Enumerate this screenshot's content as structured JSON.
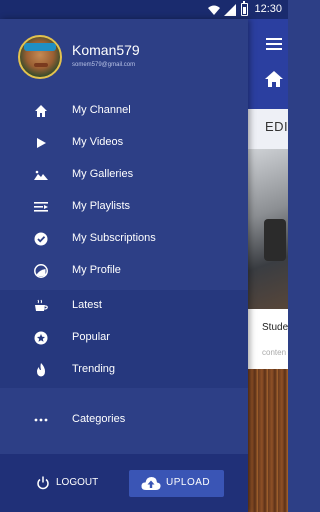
{
  "status_bar": {
    "time": "12:30"
  },
  "drawer": {
    "profile": {
      "username": "Koman579",
      "email": "somem579@gmail.com"
    },
    "primary_items": [
      {
        "label": "My Channel",
        "icon": "home-icon"
      },
      {
        "label": "My Videos",
        "icon": "play-icon"
      },
      {
        "label": "My Galleries",
        "icon": "landscape-icon"
      },
      {
        "label": "My Playlists",
        "icon": "playlist-icon"
      },
      {
        "label": "My Subscriptions",
        "icon": "check-circle-icon"
      },
      {
        "label": "My Profile",
        "icon": "profile-icon"
      }
    ],
    "feed_items": [
      {
        "label": "Latest",
        "icon": "coffee-cup-icon"
      },
      {
        "label": "Popular",
        "icon": "star-circle-icon"
      },
      {
        "label": "Trending",
        "icon": "fire-icon"
      }
    ],
    "more_items": [
      {
        "label": "Categories",
        "icon": "more-dots-icon"
      }
    ],
    "footer": {
      "logout_label": "LOGOUT",
      "upload_label": "UPLOAD"
    }
  },
  "background_app": {
    "tab_label": "EDIT",
    "card_title": "Stude In A C",
    "card_meta": "conten"
  },
  "colors": {
    "drawer_bg": "#2d3f86",
    "drawer_footer": "#203078",
    "upload_button": "#3a55b5",
    "app_bar": "#2b3fa0"
  }
}
